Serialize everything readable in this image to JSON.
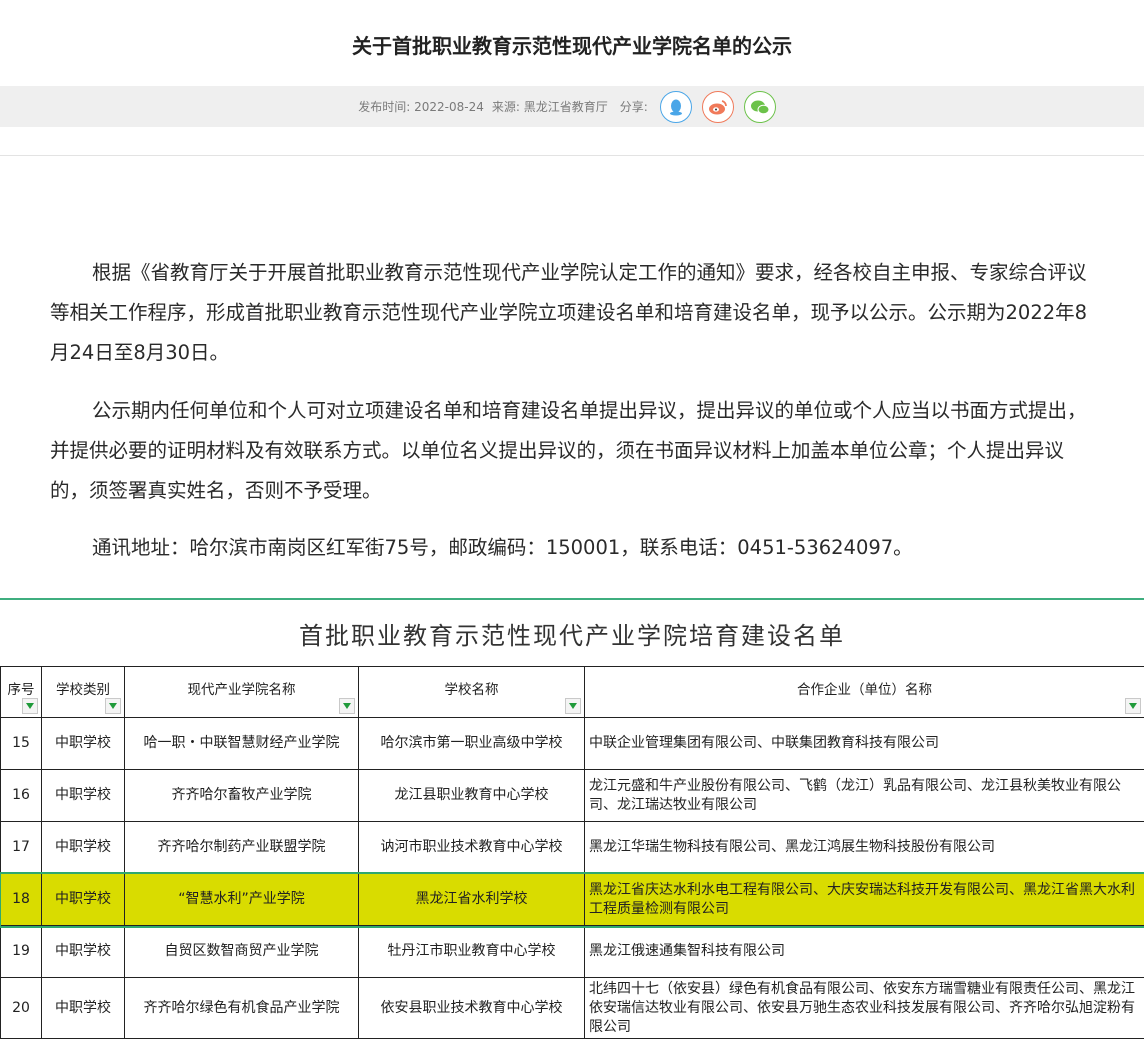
{
  "article": {
    "title": "关于首批职业教育示范性现代产业学院名单的公示",
    "publish_label": "发布时间:",
    "publish_date": "2022-08-24",
    "source_label": "来源:",
    "source": "黑龙江省教育厅",
    "share_label": "分享:",
    "share_icons": [
      "qq-icon",
      "weibo-icon",
      "wechat-icon"
    ],
    "paragraphs": [
      "根据《省教育厅关于开展首批职业教育示范性现代产业学院认定工作的通知》要求，经各校自主申报、专家综合评议等相关工作程序，形成首批职业教育示范性现代产业学院立项建设名单和培育建设名单，现予以公示。公示期为2022年8月24日至8月30日。",
      "公示期内任何单位和个人可对立项建设名单和培育建设名单提出异议，提出异议的单位或个人应当以书面方式提出，并提供必要的证明材料及有效联系方式。以单位名义提出异议的，须在书面异议材料上加盖本单位公章；个人提出异议的，须签署真实姓名，否则不予受理。",
      "通讯地址：哈尔滨市南岗区红军街75号，邮政编码：150001，联系电话：0451-53624097。"
    ]
  },
  "sheet": {
    "title": "首批职业教育示范性现代产业学院培育建设名单",
    "headers": [
      "序号",
      "学校类别",
      "现代产业学院名称",
      "学校名称",
      "合作企业（单位）名称"
    ],
    "rows": [
      {
        "no": "15",
        "type": "中职学校",
        "college": "哈一职・中联智慧财经产业学院",
        "school": "哈尔滨市第一职业高级中学校",
        "partners": "中联企业管理集团有限公司、中联集团教育科技有限公司"
      },
      {
        "no": "16",
        "type": "中职学校",
        "college": "齐齐哈尔畜牧产业学院",
        "school": "龙江县职业教育中心学校",
        "partners": "龙江元盛和牛产业股份有限公司、飞鹤（龙江）乳品有限公司、龙江县秋美牧业有限公司、龙江瑞达牧业有限公司"
      },
      {
        "no": "17",
        "type": "中职学校",
        "college": "齐齐哈尔制药产业联盟学院",
        "school": "讷河市职业技术教育中心学校",
        "partners": "黑龙江华瑞生物科技有限公司、黑龙江鸿展生物科技股份有限公司"
      },
      {
        "no": "18",
        "type": "中职学校",
        "college": "“智慧水利”产业学院",
        "school": "黑龙江省水利学校",
        "partners": "黑龙江省庆达水利水电工程有限公司、大庆安瑞达科技开发有限公司、黑龙江省黑大水利工程质量检测有限公司"
      },
      {
        "no": "19",
        "type": "中职学校",
        "college": "自贸区数智商贸产业学院",
        "school": "牡丹江市职业教育中心学校",
        "partners": "黑龙江俄速通集智科技有限公司"
      },
      {
        "no": "20",
        "type": "中职学校",
        "college": "齐齐哈尔绿色有机食品产业学院",
        "school": "依安县职业技术教育中心学校",
        "partners": "北纬四十七（依安县）绿色有机食品有限公司、依安东方瑞雪糖业有限责任公司、黑龙江依安瑞信达牧业有限公司、依安县万驰生态农业科技发展有限公司、齐齐哈尔弘旭淀粉有限公司"
      }
    ],
    "highlighted_row": "18",
    "colors": {
      "highlight": "#d9dc00",
      "accent": "#3fae7f"
    }
  }
}
